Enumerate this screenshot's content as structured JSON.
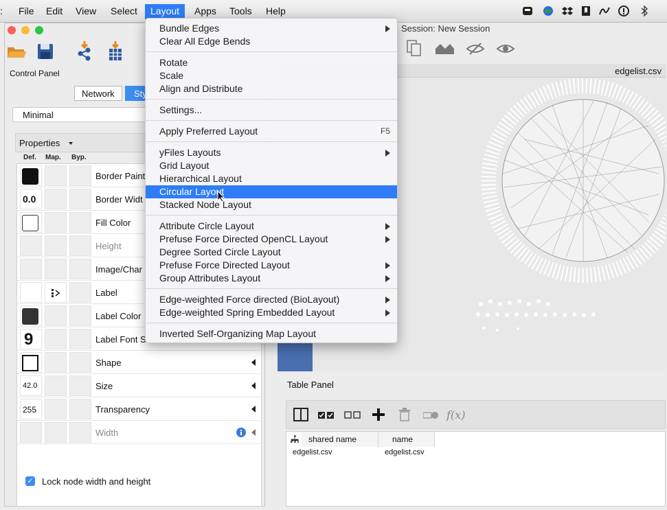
{
  "menubar": {
    "items": [
      "File",
      "Edit",
      "View",
      "Select",
      "Layout",
      "Apps",
      "Tools",
      "Help"
    ],
    "active": "Layout",
    "accent": "#2f7cf6",
    "tray_icons": [
      "app-icon",
      "globe-icon",
      "dropbox-icon",
      "bookmark-icon",
      "script-icon",
      "info-icon",
      "bluetooth-icon"
    ]
  },
  "left_window": {
    "control_panel_label": "Control Panel",
    "tabs": [
      "Network",
      "Sty"
    ],
    "selected_tab": "Sty",
    "style_select": "Minimal",
    "properties_title": "Properties",
    "columns": [
      "Def.",
      "Map.",
      "Byp."
    ],
    "properties": [
      {
        "name": "Border Paint",
        "default": "",
        "swatch": "#111111",
        "dim": false
      },
      {
        "name": "Border Widt",
        "default": "0.0",
        "dim": false
      },
      {
        "name": "Fill Color",
        "default": "",
        "swatch": "#ffffff",
        "dim": false
      },
      {
        "name": "Height",
        "default": "",
        "dim": true
      },
      {
        "name": "Image/Char",
        "default": "",
        "dim": false
      },
      {
        "name": "Label",
        "default": "",
        "dim": false
      },
      {
        "name": "Label Color",
        "default": "",
        "swatch": "#333333",
        "dim": false
      },
      {
        "name": "Label Font S",
        "default": "9",
        "dim": false
      },
      {
        "name": "Shape",
        "default": "",
        "dim": false,
        "expandable": true
      },
      {
        "name": "Size",
        "default": "42.0",
        "dim": false,
        "expandable": true
      },
      {
        "name": "Transparency",
        "default": "255",
        "dim": false,
        "expandable": true
      },
      {
        "name": "Width",
        "default": "",
        "dim": true,
        "expandable": true
      }
    ],
    "lock_label": "Lock node width and height"
  },
  "right_window": {
    "session_title": "Session: New Session",
    "network_title": "edgelist.csv",
    "table_panel_label": "Table Panel",
    "table_columns": [
      "shared name",
      "name"
    ],
    "table_rows": [
      [
        "edgelist.csv",
        "edgelist.csv"
      ]
    ]
  },
  "layout_menu": {
    "groups": [
      [
        {
          "label": "Bundle Edges",
          "submenu": true
        },
        {
          "label": "Clear All Edge Bends"
        }
      ],
      [
        {
          "label": "Rotate"
        },
        {
          "label": "Scale"
        },
        {
          "label": "Align and Distribute"
        }
      ],
      [
        {
          "label": "Settings..."
        }
      ],
      [
        {
          "label": "Apply Preferred Layout",
          "shortcut": "F5"
        }
      ],
      [
        {
          "label": "yFiles Layouts",
          "submenu": true
        },
        {
          "label": "Grid Layout"
        },
        {
          "label": "Hierarchical Layout"
        },
        {
          "label": "Circular Layout",
          "highlighted": true
        },
        {
          "label": "Stacked Node Layout"
        }
      ],
      [
        {
          "label": "Attribute Circle Layout",
          "submenu": true
        },
        {
          "label": "Prefuse Force Directed OpenCL Layout",
          "submenu": true
        },
        {
          "label": "Degree Sorted Circle Layout"
        },
        {
          "label": "Prefuse Force Directed Layout",
          "submenu": true
        },
        {
          "label": "Group Attributes Layout",
          "submenu": true
        }
      ],
      [
        {
          "label": "Edge-weighted Force directed (BioLayout)",
          "submenu": true
        },
        {
          "label": "Edge-weighted Spring Embedded Layout",
          "submenu": true
        }
      ],
      [
        {
          "label": "Inverted Self-Organizing Map Layout"
        }
      ]
    ]
  }
}
